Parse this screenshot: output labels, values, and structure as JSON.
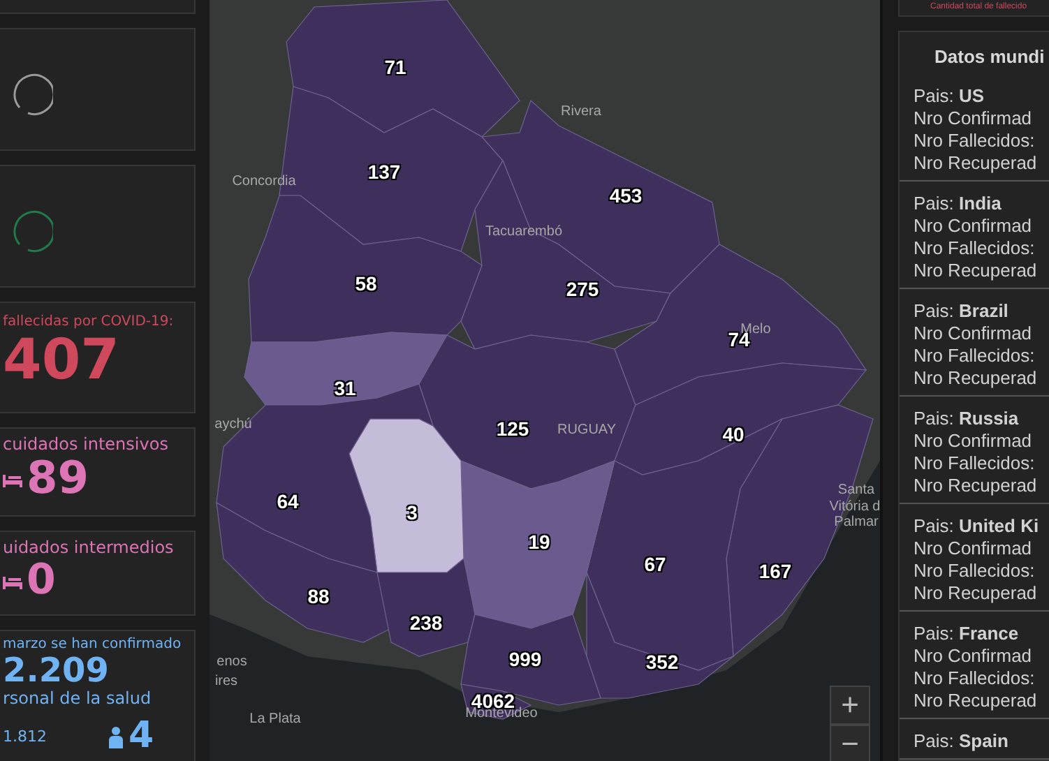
{
  "left_cards": [
    {
      "kind": "blank"
    },
    {
      "kind": "spinner",
      "color": "#9a9a9a"
    },
    {
      "kind": "spinner",
      "color": "#1f7a4d"
    },
    {
      "kind": "stat",
      "label": "fallecidas por COVID-19:",
      "value": "407",
      "color": "#d0485c"
    },
    {
      "kind": "stat_bed",
      "label": "cuidados intensivos",
      "value": "89",
      "color": "#dd74b5"
    },
    {
      "kind": "stat_bed",
      "label": "uidados intermedios",
      "value": "0",
      "color": "#dd74b5"
    },
    {
      "kind": "confirmed",
      "label": "marzo se han confirmado",
      "value": "2.209",
      "sublabel": "rsonal de la salud",
      "small": "1.812",
      "count": "4",
      "color": "#6fb3f5"
    }
  ],
  "map": {
    "departments": [
      {
        "value": "71",
        "color": "#3f2f5c"
      },
      {
        "value": "137",
        "color": "#3f2f5c"
      },
      {
        "value": "453",
        "color": "#3f2f5c"
      },
      {
        "value": "275",
        "color": "#3f2f5c"
      },
      {
        "value": "58",
        "color": "#3f2f5c"
      },
      {
        "value": "31",
        "color": "#6a5a8e"
      },
      {
        "value": "125",
        "color": "#3f2f5c"
      },
      {
        "value": "74",
        "color": "#3f2f5c"
      },
      {
        "value": "40",
        "color": "#3f2f5c"
      },
      {
        "value": "167",
        "color": "#3f2f5c"
      },
      {
        "value": "67",
        "color": "#3f2f5c"
      },
      {
        "value": "352",
        "color": "#3f2f5c"
      },
      {
        "value": "19",
        "color": "#6a5a8e"
      },
      {
        "value": "3",
        "color": "#c4bcd8"
      },
      {
        "value": "64",
        "color": "#3f2f5c"
      },
      {
        "value": "88",
        "color": "#3f2f5c"
      },
      {
        "value": "238",
        "color": "#3f2f5c"
      },
      {
        "value": "999",
        "color": "#3f2f5c"
      },
      {
        "value": "4062",
        "color": "#3f2f5c"
      }
    ],
    "places": [
      "Rivera",
      "Concordia",
      "Tacuarembó",
      "Melo",
      "RUGUAY",
      "aychú",
      "Santa",
      "Vitória d",
      "Palmar",
      "enos",
      "ires",
      "La Plata",
      "Montevideo"
    ],
    "zoom_in": "+",
    "zoom_out": "−"
  },
  "right": {
    "top_note": "Cantidad total de fallecido",
    "title": "Datos mundi",
    "countries": [
      {
        "heading": "Pais: **US**",
        "lines": [
          "Nro Confirmad",
          "Nro Fallecidos:",
          "Nro Recuperad"
        ]
      },
      {
        "heading": "Pais: **India**",
        "lines": [
          "Nro Confirmad",
          "Nro Fallecidos:",
          "Nro Recuperad"
        ]
      },
      {
        "heading": "Pais: **Brazil**",
        "lines": [
          "Nro Confirmad",
          "Nro Fallecidos:",
          "Nro Recuperad"
        ]
      },
      {
        "heading": "Pais: **Russia**",
        "lines": [
          "Nro Confirmad",
          "Nro Fallecidos:",
          "Nro Recuperad"
        ]
      },
      {
        "heading": "Pais: **United Ki**",
        "lines": [
          "Nro Confirmad",
          "Nro Fallecidos:",
          "Nro Recuperad"
        ]
      },
      {
        "heading": "Pais: **France**",
        "lines": [
          "Nro Confirmad",
          "Nro Fallecidos:",
          "Nro Recuperad"
        ]
      },
      {
        "heading": "Pais: **Spain**"
      }
    ]
  }
}
